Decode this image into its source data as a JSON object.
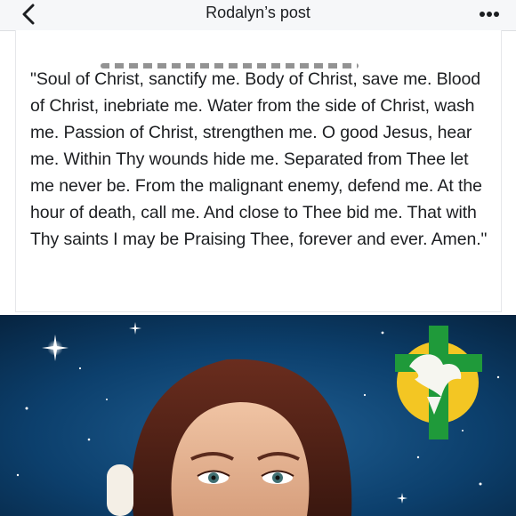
{
  "header": {
    "title": "Rodalyn’s post",
    "back_icon": "chevron-left-icon",
    "more_icon": "ellipsis-icon"
  },
  "post": {
    "text": "\"Soul of Christ, sanctify me. Body of Christ, save me. Blood of Christ, inebriate me. Water from the side of Christ, wash me. Passion of Christ, strengthen me. O good Jesus, hear me. Within Thy wounds hide me. Separated from Thee let me never be. From the malignant enemy, defend me. At the hour of death, call me. And close to Thee bid me. That with Thy saints I may be Praising Thee, forever and ever. Amen.\""
  },
  "colors": {
    "bar_bg": "#f6f7f9",
    "text": "#1c1e21",
    "sky": "#0b3f6e",
    "cross": "#1f9a3a",
    "halo": "#f3c623"
  }
}
